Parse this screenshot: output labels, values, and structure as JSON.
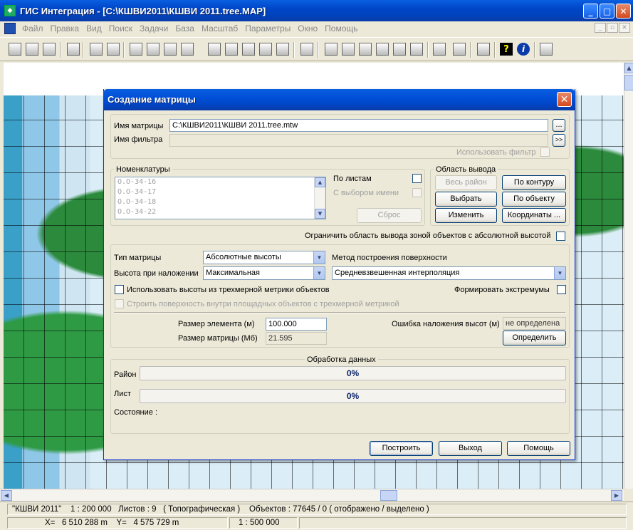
{
  "window": {
    "title": "ГИС Интеграция - [C:\\КШВИ2011\\КШВИ 2011.tree.MAP]",
    "minimize": "_",
    "maximize": "□",
    "close": "✕"
  },
  "menu": [
    "Файл",
    "Правка",
    "Вид",
    "Поиск",
    "Задачи",
    "База",
    "Масштаб",
    "Параметры",
    "Окно",
    "Помощь"
  ],
  "toolbar": {
    "help_glyph": "?",
    "info_glyph": "i"
  },
  "dialog": {
    "title": "Создание матрицы",
    "close": "✕",
    "matrix_name_label": "Имя матрицы",
    "matrix_name_value": "C:\\КШВИ2011\\КШВИ 2011.tree.mtw",
    "browse_button": "...",
    "filter_name_label": "Имя фильтра",
    "filter_name_value": "",
    "filter_button": ">>",
    "use_filter_label": "Использовать фильтр",
    "nomenclature": {
      "label": "Номенклатуры",
      "items": [
        "O.O-34-16",
        "O.O-34-17",
        "O.O-34-18",
        "O.O-34-22"
      ],
      "by_sheets_label": "По листам",
      "name_select_label": "С выбором имени",
      "reset_button": "Сброс"
    },
    "output_area": {
      "label": "Область вывода",
      "whole_area_button": "Весь район",
      "by_contour_button": "По контуру",
      "select_button": "Выбрать",
      "by_object_button": "По объекту",
      "change_button": "Изменить",
      "coordinates_button": "Координаты ..."
    },
    "limit_output_label": "Ограничить область вывода зоной объектов с абсолютной высотой",
    "matrix_type_label": "Тип матрицы",
    "matrix_type_value": "Абсолютные высоты",
    "surface_method_label": "Метод построения поверхности",
    "surface_method_value": "Средневзвешенная интерполяция",
    "overlay_height_label": "Высота при наложении",
    "overlay_height_value": "Максимальная",
    "use_3d_heights_label": "Использовать высоты из трехмерной метрики объектов",
    "form_extremes_label": "Формировать экстремумы",
    "build_inside_label": "Строить поверхность внутри площадных объектов с трехмерной метрикой",
    "element_size_label": "Размер элемента (м)",
    "element_size_value": "100.000",
    "matrix_size_label": "Размер матрицы (Мб)",
    "matrix_size_value": "21.595",
    "overlay_error_label": "Ошибка наложения высот (м)",
    "overlay_error_value": "не определена",
    "determine_button": "Определить",
    "processing": {
      "label": "Обработка данных",
      "area_label": "Район",
      "area_progress": "0%",
      "sheet_label": "Лист",
      "sheet_progress": "0%",
      "state_label": "Состояние :"
    },
    "build_button": "Построить",
    "exit_button": "Выход",
    "help_button": "Помощь"
  },
  "status": {
    "line1": "\"КШВИ 2011\"    1 : 200 000   Листов : 9   ( Топографическая )    Объектов : 77645 / 0 ( отображено / выделено )",
    "coords": "X=   6 510 288 m    Y=   4 575 729 m",
    "scale": "1 : 500 000"
  },
  "colors": {
    "title_blue": "#0046c8",
    "progress_text": "#0a246a",
    "map_green": "#2c8a3c",
    "map_water": "#dbeef7"
  }
}
